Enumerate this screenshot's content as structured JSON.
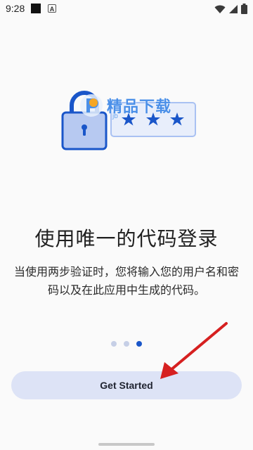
{
  "status_bar": {
    "time": "9:28",
    "notification_icons": [
      "square-notification-icon",
      "a-notification-icon"
    ],
    "notification_a_letter": "A",
    "system_icons": [
      "wifi-icon",
      "cellular-icon",
      "battery-icon"
    ]
  },
  "watermark": {
    "text": "精品下载",
    "sub": "jb"
  },
  "onboarding": {
    "title": "使用唯一的代码登录",
    "description": "当使用两步验证时，您将输入您的用户名和密码以及在此应用中生成的代码。",
    "page_indicator": {
      "total": 3,
      "current": 3
    },
    "password_mask": "***"
  },
  "buttons": {
    "get_started": "Get Started"
  },
  "colors": {
    "accent": "#1a56c9",
    "button_bg": "#dde3f6",
    "annotation_arrow": "#d62020"
  }
}
